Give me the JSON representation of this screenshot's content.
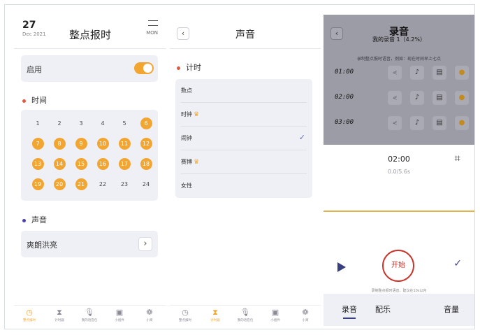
{
  "panel1": {
    "date_day": "27",
    "date_month": "Dec 2021",
    "title": "整点报时",
    "weekday": "MON",
    "enable_label": "启用",
    "enable_on": true,
    "time_section": "时间",
    "time_dot_color": "#e2583e",
    "hours": [
      "1",
      "2",
      "3",
      "4",
      "5",
      "6",
      "7",
      "8",
      "9",
      "10",
      "11",
      "12",
      "13",
      "14",
      "15",
      "16",
      "17",
      "18",
      "19",
      "20",
      "21",
      "22",
      "23",
      "24"
    ],
    "active_hours": [
      "6",
      "7",
      "8",
      "9",
      "10",
      "11",
      "12",
      "13",
      "14",
      "15",
      "16",
      "17",
      "18",
      "19",
      "20",
      "21"
    ],
    "sound_section": "声音",
    "sound_dot_color": "#4b3fb0",
    "sound_name": "爽朗洪亮",
    "accent": "#f2a631"
  },
  "tabbar1": [
    {
      "label": "整点报时",
      "icon": "clock-icon",
      "active": true
    },
    {
      "label": "计时器",
      "icon": "hourglass-icon",
      "active": false
    },
    {
      "label": "我的语音包",
      "icon": "mic-icon",
      "active": false
    },
    {
      "label": "小组件",
      "icon": "widget-icon",
      "active": false
    },
    {
      "label": "小窝",
      "icon": "home-icon",
      "active": false
    }
  ],
  "panel2": {
    "title": "声音",
    "section": "计时",
    "items": [
      {
        "label": "数点",
        "crown": false,
        "checked": false
      },
      {
        "label": "时钟",
        "crown": true,
        "checked": false
      },
      {
        "label": "闹钟",
        "crown": false,
        "checked": true
      },
      {
        "label": "赛博",
        "crown": true,
        "checked": false
      },
      {
        "label": "女性",
        "crown": false,
        "checked": false
      }
    ]
  },
  "tabbar2": [
    {
      "label": "整点报时",
      "icon": "clock-icon",
      "active": false
    },
    {
      "label": "计时器",
      "icon": "hourglass-icon",
      "active": true
    },
    {
      "label": "我的语音包",
      "icon": "mic-icon",
      "active": false
    },
    {
      "label": "小组件",
      "icon": "widget-icon",
      "active": false
    },
    {
      "label": "小窝",
      "icon": "home-icon",
      "active": false
    }
  ],
  "panel3": {
    "title": "录音",
    "subtitle": "我的录音 1（4.2%）",
    "hint": "录制整点报时语音，例如：现在时间早上七点",
    "rows": [
      "01:00",
      "02:00",
      "03:00"
    ],
    "sheet_time": "02:00",
    "sheet_duration": "0.0/5.6s",
    "start_label": "开始",
    "note": "录制整点报时语音，建议在10s以内",
    "tabs": [
      {
        "label": "录音",
        "active": true
      },
      {
        "label": "配乐",
        "active": false
      },
      {
        "label": "音量",
        "active": false
      }
    ]
  }
}
